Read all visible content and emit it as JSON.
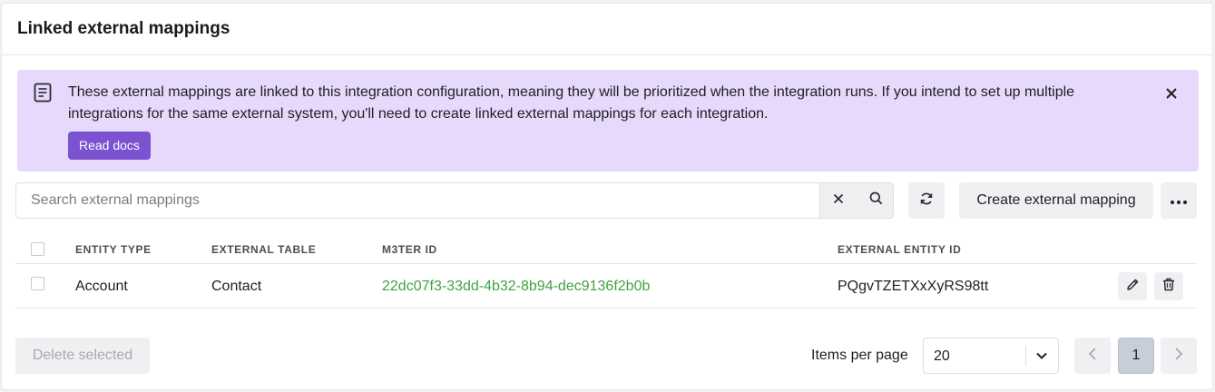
{
  "card": {
    "title": "Linked external mappings"
  },
  "banner": {
    "icon": "document-icon",
    "message": "These external mappings are linked to this integration configuration, meaning they will be prioritized when the integration runs. If you intend to set up multiple integrations for the same external system, you'll need to create linked external mappings for each integration.",
    "read_docs_label": "Read docs",
    "close_icon": "close-icon",
    "background": "#e6d9fb",
    "button_color": "#7b52cf"
  },
  "toolbar": {
    "search_placeholder": "Search external mappings",
    "search_value": "",
    "create_label": "Create external mapping"
  },
  "table": {
    "columns": [
      "ENTITY TYPE",
      "EXTERNAL TABLE",
      "M3TER ID",
      "EXTERNAL ENTITY ID"
    ],
    "rows": [
      {
        "selected": false,
        "entity_type": "Account",
        "external_table": "Contact",
        "m3ter_id": "22dc07f3-33dd-4b32-8b94-dec9136f2b0b",
        "external_entity_id": "PQgvTZETXxXyRS98tt"
      }
    ],
    "link_color": "#3fa33f"
  },
  "footer": {
    "delete_label": "Delete selected",
    "delete_enabled": false,
    "items_per_page_label": "Items per page",
    "items_per_page_value": "20",
    "current_page": "1"
  }
}
